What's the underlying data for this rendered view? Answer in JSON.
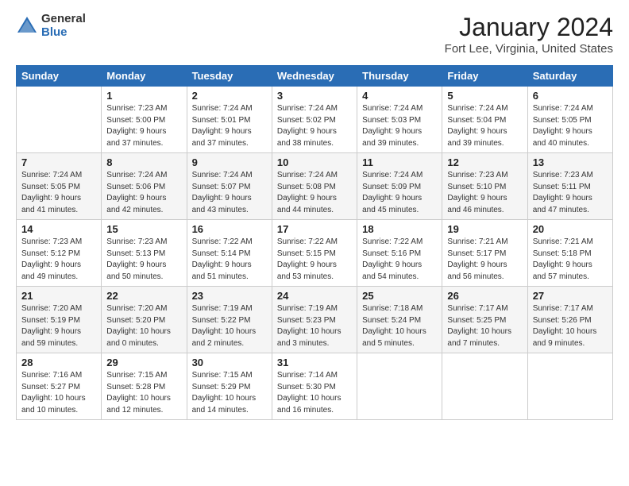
{
  "header": {
    "logo_general": "General",
    "logo_blue": "Blue",
    "month_title": "January 2024",
    "location": "Fort Lee, Virginia, United States"
  },
  "days_of_week": [
    "Sunday",
    "Monday",
    "Tuesday",
    "Wednesday",
    "Thursday",
    "Friday",
    "Saturday"
  ],
  "weeks": [
    [
      {
        "day": "",
        "info": ""
      },
      {
        "day": "1",
        "info": "Sunrise: 7:23 AM\nSunset: 5:00 PM\nDaylight: 9 hours\nand 37 minutes."
      },
      {
        "day": "2",
        "info": "Sunrise: 7:24 AM\nSunset: 5:01 PM\nDaylight: 9 hours\nand 37 minutes."
      },
      {
        "day": "3",
        "info": "Sunrise: 7:24 AM\nSunset: 5:02 PM\nDaylight: 9 hours\nand 38 minutes."
      },
      {
        "day": "4",
        "info": "Sunrise: 7:24 AM\nSunset: 5:03 PM\nDaylight: 9 hours\nand 39 minutes."
      },
      {
        "day": "5",
        "info": "Sunrise: 7:24 AM\nSunset: 5:04 PM\nDaylight: 9 hours\nand 39 minutes."
      },
      {
        "day": "6",
        "info": "Sunrise: 7:24 AM\nSunset: 5:05 PM\nDaylight: 9 hours\nand 40 minutes."
      }
    ],
    [
      {
        "day": "7",
        "info": "Sunrise: 7:24 AM\nSunset: 5:05 PM\nDaylight: 9 hours\nand 41 minutes."
      },
      {
        "day": "8",
        "info": "Sunrise: 7:24 AM\nSunset: 5:06 PM\nDaylight: 9 hours\nand 42 minutes."
      },
      {
        "day": "9",
        "info": "Sunrise: 7:24 AM\nSunset: 5:07 PM\nDaylight: 9 hours\nand 43 minutes."
      },
      {
        "day": "10",
        "info": "Sunrise: 7:24 AM\nSunset: 5:08 PM\nDaylight: 9 hours\nand 44 minutes."
      },
      {
        "day": "11",
        "info": "Sunrise: 7:24 AM\nSunset: 5:09 PM\nDaylight: 9 hours\nand 45 minutes."
      },
      {
        "day": "12",
        "info": "Sunrise: 7:23 AM\nSunset: 5:10 PM\nDaylight: 9 hours\nand 46 minutes."
      },
      {
        "day": "13",
        "info": "Sunrise: 7:23 AM\nSunset: 5:11 PM\nDaylight: 9 hours\nand 47 minutes."
      }
    ],
    [
      {
        "day": "14",
        "info": "Sunrise: 7:23 AM\nSunset: 5:12 PM\nDaylight: 9 hours\nand 49 minutes."
      },
      {
        "day": "15",
        "info": "Sunrise: 7:23 AM\nSunset: 5:13 PM\nDaylight: 9 hours\nand 50 minutes."
      },
      {
        "day": "16",
        "info": "Sunrise: 7:22 AM\nSunset: 5:14 PM\nDaylight: 9 hours\nand 51 minutes."
      },
      {
        "day": "17",
        "info": "Sunrise: 7:22 AM\nSunset: 5:15 PM\nDaylight: 9 hours\nand 53 minutes."
      },
      {
        "day": "18",
        "info": "Sunrise: 7:22 AM\nSunset: 5:16 PM\nDaylight: 9 hours\nand 54 minutes."
      },
      {
        "day": "19",
        "info": "Sunrise: 7:21 AM\nSunset: 5:17 PM\nDaylight: 9 hours\nand 56 minutes."
      },
      {
        "day": "20",
        "info": "Sunrise: 7:21 AM\nSunset: 5:18 PM\nDaylight: 9 hours\nand 57 minutes."
      }
    ],
    [
      {
        "day": "21",
        "info": "Sunrise: 7:20 AM\nSunset: 5:19 PM\nDaylight: 9 hours\nand 59 minutes."
      },
      {
        "day": "22",
        "info": "Sunrise: 7:20 AM\nSunset: 5:20 PM\nDaylight: 10 hours\nand 0 minutes."
      },
      {
        "day": "23",
        "info": "Sunrise: 7:19 AM\nSunset: 5:22 PM\nDaylight: 10 hours\nand 2 minutes."
      },
      {
        "day": "24",
        "info": "Sunrise: 7:19 AM\nSunset: 5:23 PM\nDaylight: 10 hours\nand 3 minutes."
      },
      {
        "day": "25",
        "info": "Sunrise: 7:18 AM\nSunset: 5:24 PM\nDaylight: 10 hours\nand 5 minutes."
      },
      {
        "day": "26",
        "info": "Sunrise: 7:17 AM\nSunset: 5:25 PM\nDaylight: 10 hours\nand 7 minutes."
      },
      {
        "day": "27",
        "info": "Sunrise: 7:17 AM\nSunset: 5:26 PM\nDaylight: 10 hours\nand 9 minutes."
      }
    ],
    [
      {
        "day": "28",
        "info": "Sunrise: 7:16 AM\nSunset: 5:27 PM\nDaylight: 10 hours\nand 10 minutes."
      },
      {
        "day": "29",
        "info": "Sunrise: 7:15 AM\nSunset: 5:28 PM\nDaylight: 10 hours\nand 12 minutes."
      },
      {
        "day": "30",
        "info": "Sunrise: 7:15 AM\nSunset: 5:29 PM\nDaylight: 10 hours\nand 14 minutes."
      },
      {
        "day": "31",
        "info": "Sunrise: 7:14 AM\nSunset: 5:30 PM\nDaylight: 10 hours\nand 16 minutes."
      },
      {
        "day": "",
        "info": ""
      },
      {
        "day": "",
        "info": ""
      },
      {
        "day": "",
        "info": ""
      }
    ]
  ]
}
